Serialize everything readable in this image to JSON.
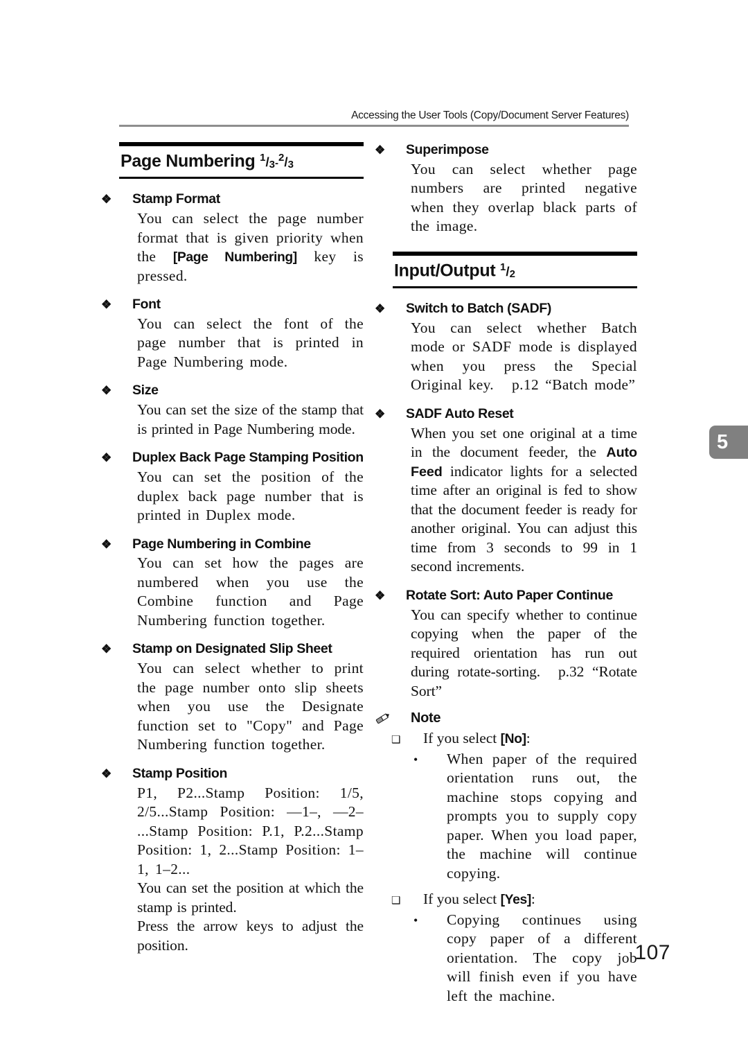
{
  "header": {
    "running_title": "Accessing the User Tools (Copy/Document Server Features)"
  },
  "chapter_tab": {
    "number": "5"
  },
  "folio": {
    "page_number": "107"
  },
  "left_column": {
    "section": {
      "title_text": "Page Numbering ",
      "fraction_1_num": "1",
      "fraction_1_den": "3",
      "fraction_sep": "-",
      "fraction_2_num": "2",
      "fraction_2_den": "3"
    },
    "entries": [
      {
        "title": "Stamp Format",
        "body_pre": "You can select the page number format that is given priority when the ",
        "keycap": "[Page Numbering]",
        "body_post": " key is pressed."
      },
      {
        "title": "Font",
        "body": "You can select the font of the page number that is printed in Page Numbering mode."
      },
      {
        "title": "Size",
        "body": "You can set the size of the stamp that is printed in Page Numbering mode."
      },
      {
        "title": "Duplex Back Page Stamping Position",
        "body": "You can set the position of the duplex back page number that is printed in Duplex mode."
      },
      {
        "title": "Page Numbering in Combine",
        "body": "You can set how the pages are numbered when you use the Combine function and Page Numbering function together."
      },
      {
        "title": "Stamp on Designated Slip Sheet",
        "body": "You can select whether to print the page number onto slip sheets when you use the Designate function set to \"Copy\" and Page Numbering function together."
      },
      {
        "title": "Stamp Position",
        "body_line1": "P1, P2...Stamp Position: 1/5, 2/5...Stamp Position: —1–, —2– ...Stamp Position: P.1, P.2...Stamp Position: 1, 2...Stamp Position: 1–1, 1–2...",
        "body_line2": "You can set the position at which the stamp is printed.",
        "body_line3": "Press the arrow keys to adjust the position."
      }
    ]
  },
  "right_column": {
    "superimpose": {
      "title": "Superimpose",
      "body": "You can select whether page numbers are printed negative when they overlap black parts of the image."
    },
    "section": {
      "title_text": "Input/Output ",
      "fraction_num": "1",
      "fraction_den": "2"
    },
    "entries": [
      {
        "title": "Switch to Batch (SADF)",
        "body": "You can select whether Batch mode or SADF mode is displayed when you press the Special Original key.",
        "reference": "p.12 “Batch mode”"
      },
      {
        "title": "SADF Auto Reset",
        "body_pre": "When you set one original at a time in the document feeder, the ",
        "body_bold": "Auto Feed",
        "body_post": " indicator lights for a selected time after an original is fed to show that the document feeder is ready for another original. You can adjust this time from 3 seconds to 99 in 1 second increments."
      },
      {
        "title": "Rotate Sort: Auto Paper Continue",
        "body": "You can specify whether to continue copying when the paper of the required orientation has run out during rotate-sorting.",
        "reference": "p.32 “Rotate Sort”"
      }
    ],
    "note": {
      "heading": "Note",
      "items": [
        {
          "lead_pre": "If you select ",
          "keycap": "[No]",
          "lead_post": ":",
          "bullet": "When paper of the required orientation runs out, the machine stops copying and prompts you to supply copy paper. When you load paper, the machine will continue copying."
        },
        {
          "lead_pre": "If you select ",
          "keycap": "[Yes]",
          "lead_post": ":",
          "bullet": "Copying continues using copy paper of a different orientation. The copy job will finish even if you have left the machine."
        }
      ]
    }
  },
  "glyphs": {
    "diamond": "❖",
    "square": "❑",
    "dot": "•"
  }
}
